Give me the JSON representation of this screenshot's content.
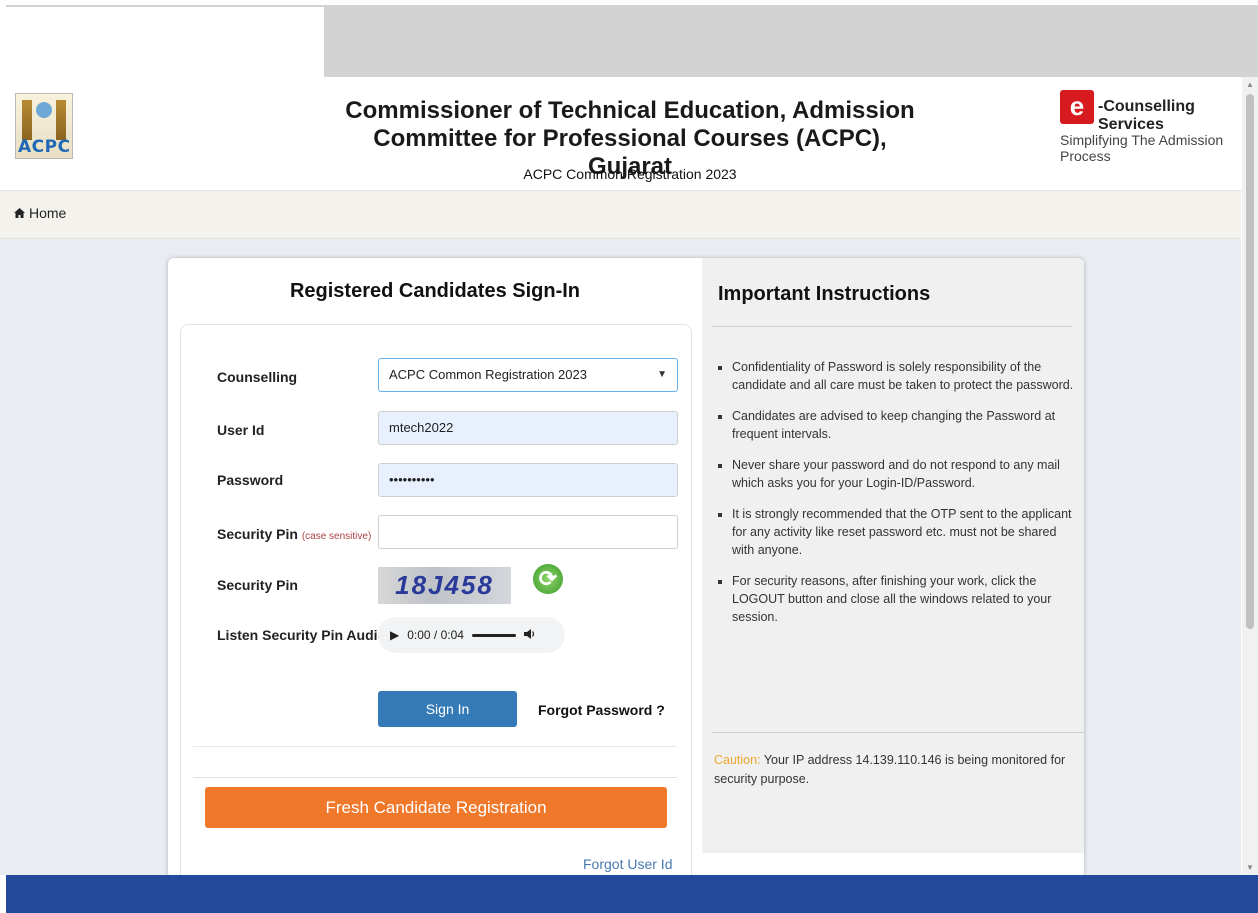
{
  "header": {
    "acpc_logo_text": "ACPC",
    "title_line1": "Commissioner of Technical Education, Admission",
    "title_line2": "Committee for Professional Courses (ACPC), Gujarat",
    "subtitle": "ACPC Common Registration 2023",
    "ec_logo_letter": "e",
    "ec_title": "-Counselling Services",
    "ec_subtitle": "Simplifying The Admission Process"
  },
  "nav": {
    "home_label": "Home"
  },
  "signin": {
    "heading": "Registered Candidates Sign-In",
    "counselling_label": "Counselling",
    "counselling_value": "ACPC Common Registration 2023",
    "userid_label": "User Id",
    "userid_value": "mtech2022",
    "password_label": "Password",
    "password_value": "••••••••••",
    "secpin_label": "Security Pin",
    "secpin_hint": "(case sensitive)",
    "secpin_value": "",
    "captcha_label": "Security Pin",
    "captcha_text": "18J458",
    "audio_label": "Listen Security Pin Audio",
    "audio_time": "0:00 / 0:04",
    "signin_button": "Sign In",
    "forgot_password": "Forgot Password ?",
    "fresh_registration": "Fresh Candidate Registration",
    "forgot_userid": "Forgot User Id"
  },
  "instructions": {
    "heading": "Important Instructions",
    "items": [
      "Confidentiality of Password is solely responsibility of the candidate and all care must be taken to protect the password.",
      "Candidates are advised to keep changing the Password at frequent intervals.",
      "Never share your password and do not respond to any mail which asks you for your Login-ID/Password.",
      "It is strongly recommended that the OTP sent to the applicant for any activity like reset password etc. must not be shared with anyone.",
      "For security reasons, after finishing your work, click the LOGOUT button and close all the windows related to your session."
    ],
    "caution_label": "Caution:",
    "caution_text": "Your IP address 14.139.110.146 is being monitored for security purpose."
  },
  "colors": {
    "primary_button": "#337ab7",
    "fresh_button": "#f0782b",
    "caution": "#f0a830",
    "footer": "#244a9b"
  }
}
